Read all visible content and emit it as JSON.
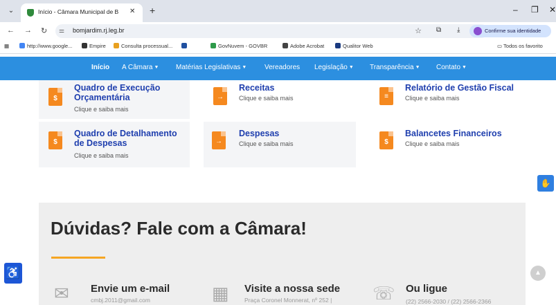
{
  "browser": {
    "tab_list_icon": "chevron-down-icon",
    "tab_title": "Início - Câmara Municipal de B",
    "tab_close": "✕",
    "new_tab": "+",
    "minimize": "–",
    "restore": "❐",
    "close_window": "✕",
    "back": "←",
    "forward": "→",
    "reload": "↻",
    "address": "bomjardim.rj.leg.br",
    "identity_button": "Confirme sua identidade",
    "bookmarks": [
      {
        "label": "http://www.google...",
        "color": "#4285f4"
      },
      {
        "label": "Empire",
        "color": "#333333"
      },
      {
        "label": "Consulta processual...",
        "color": "#e8a020"
      },
      {
        "label": "",
        "color": "#2050a0"
      },
      {
        "label": "GovNuvem - GOVBR",
        "color": "#2e9a4a"
      },
      {
        "label": "Adobe Acrobat",
        "color": "#444444"
      },
      {
        "label": "Qualitor Web",
        "color": "#1a3a80"
      }
    ],
    "all_bookmarks": "Todos os favorito"
  },
  "site_nav": {
    "items": [
      "Início",
      "A Câmara",
      "Matérias Legislativas",
      "Vereadores",
      "Legislação",
      "Transparência",
      "Contato"
    ]
  },
  "cards": [
    {
      "title": "Quadro de Execução Orçamentária",
      "subtitle": "Clique e saiba mais",
      "icon": "document-dollar-icon"
    },
    {
      "title": "Receitas",
      "subtitle": "Clique e saiba mais",
      "icon": "document-arrow-icon"
    },
    {
      "title": "Relatório de Gestão Fiscal",
      "subtitle": "Clique e saiba mais",
      "icon": "document-list-icon"
    },
    {
      "title": "Quadro de Detalhamento de Despesas",
      "subtitle": "Clique e saiba mais",
      "icon": "document-dollar-icon"
    },
    {
      "title": "Despesas",
      "subtitle": "Clique e saiba mais",
      "icon": "document-arrow-icon"
    },
    {
      "title": "Balancetes Financeiros",
      "subtitle": "Clique e saiba mais",
      "icon": "document-dollar-icon"
    }
  ],
  "doubts": {
    "title": "Dúvidas? Fale com a Câmara!",
    "contacts": [
      {
        "title": "Envie um e-mail",
        "subtitle": "cmbj.2011@gmail.com",
        "icon": "envelope-icon"
      },
      {
        "title": "Visite a nossa sede",
        "subtitle": "Praça Coronel Monnerat, nº 252 |",
        "icon": "building-icon"
      },
      {
        "title": "Ou ligue",
        "subtitle": "(22) 2566-2030 / (22) 2566-2366",
        "icon": "phone-icon"
      }
    ]
  },
  "colors": {
    "nav": "#2c8fe0",
    "card_title": "#1f3fae",
    "icon_orange": "#f5891f",
    "accent_line": "#f5a623"
  }
}
